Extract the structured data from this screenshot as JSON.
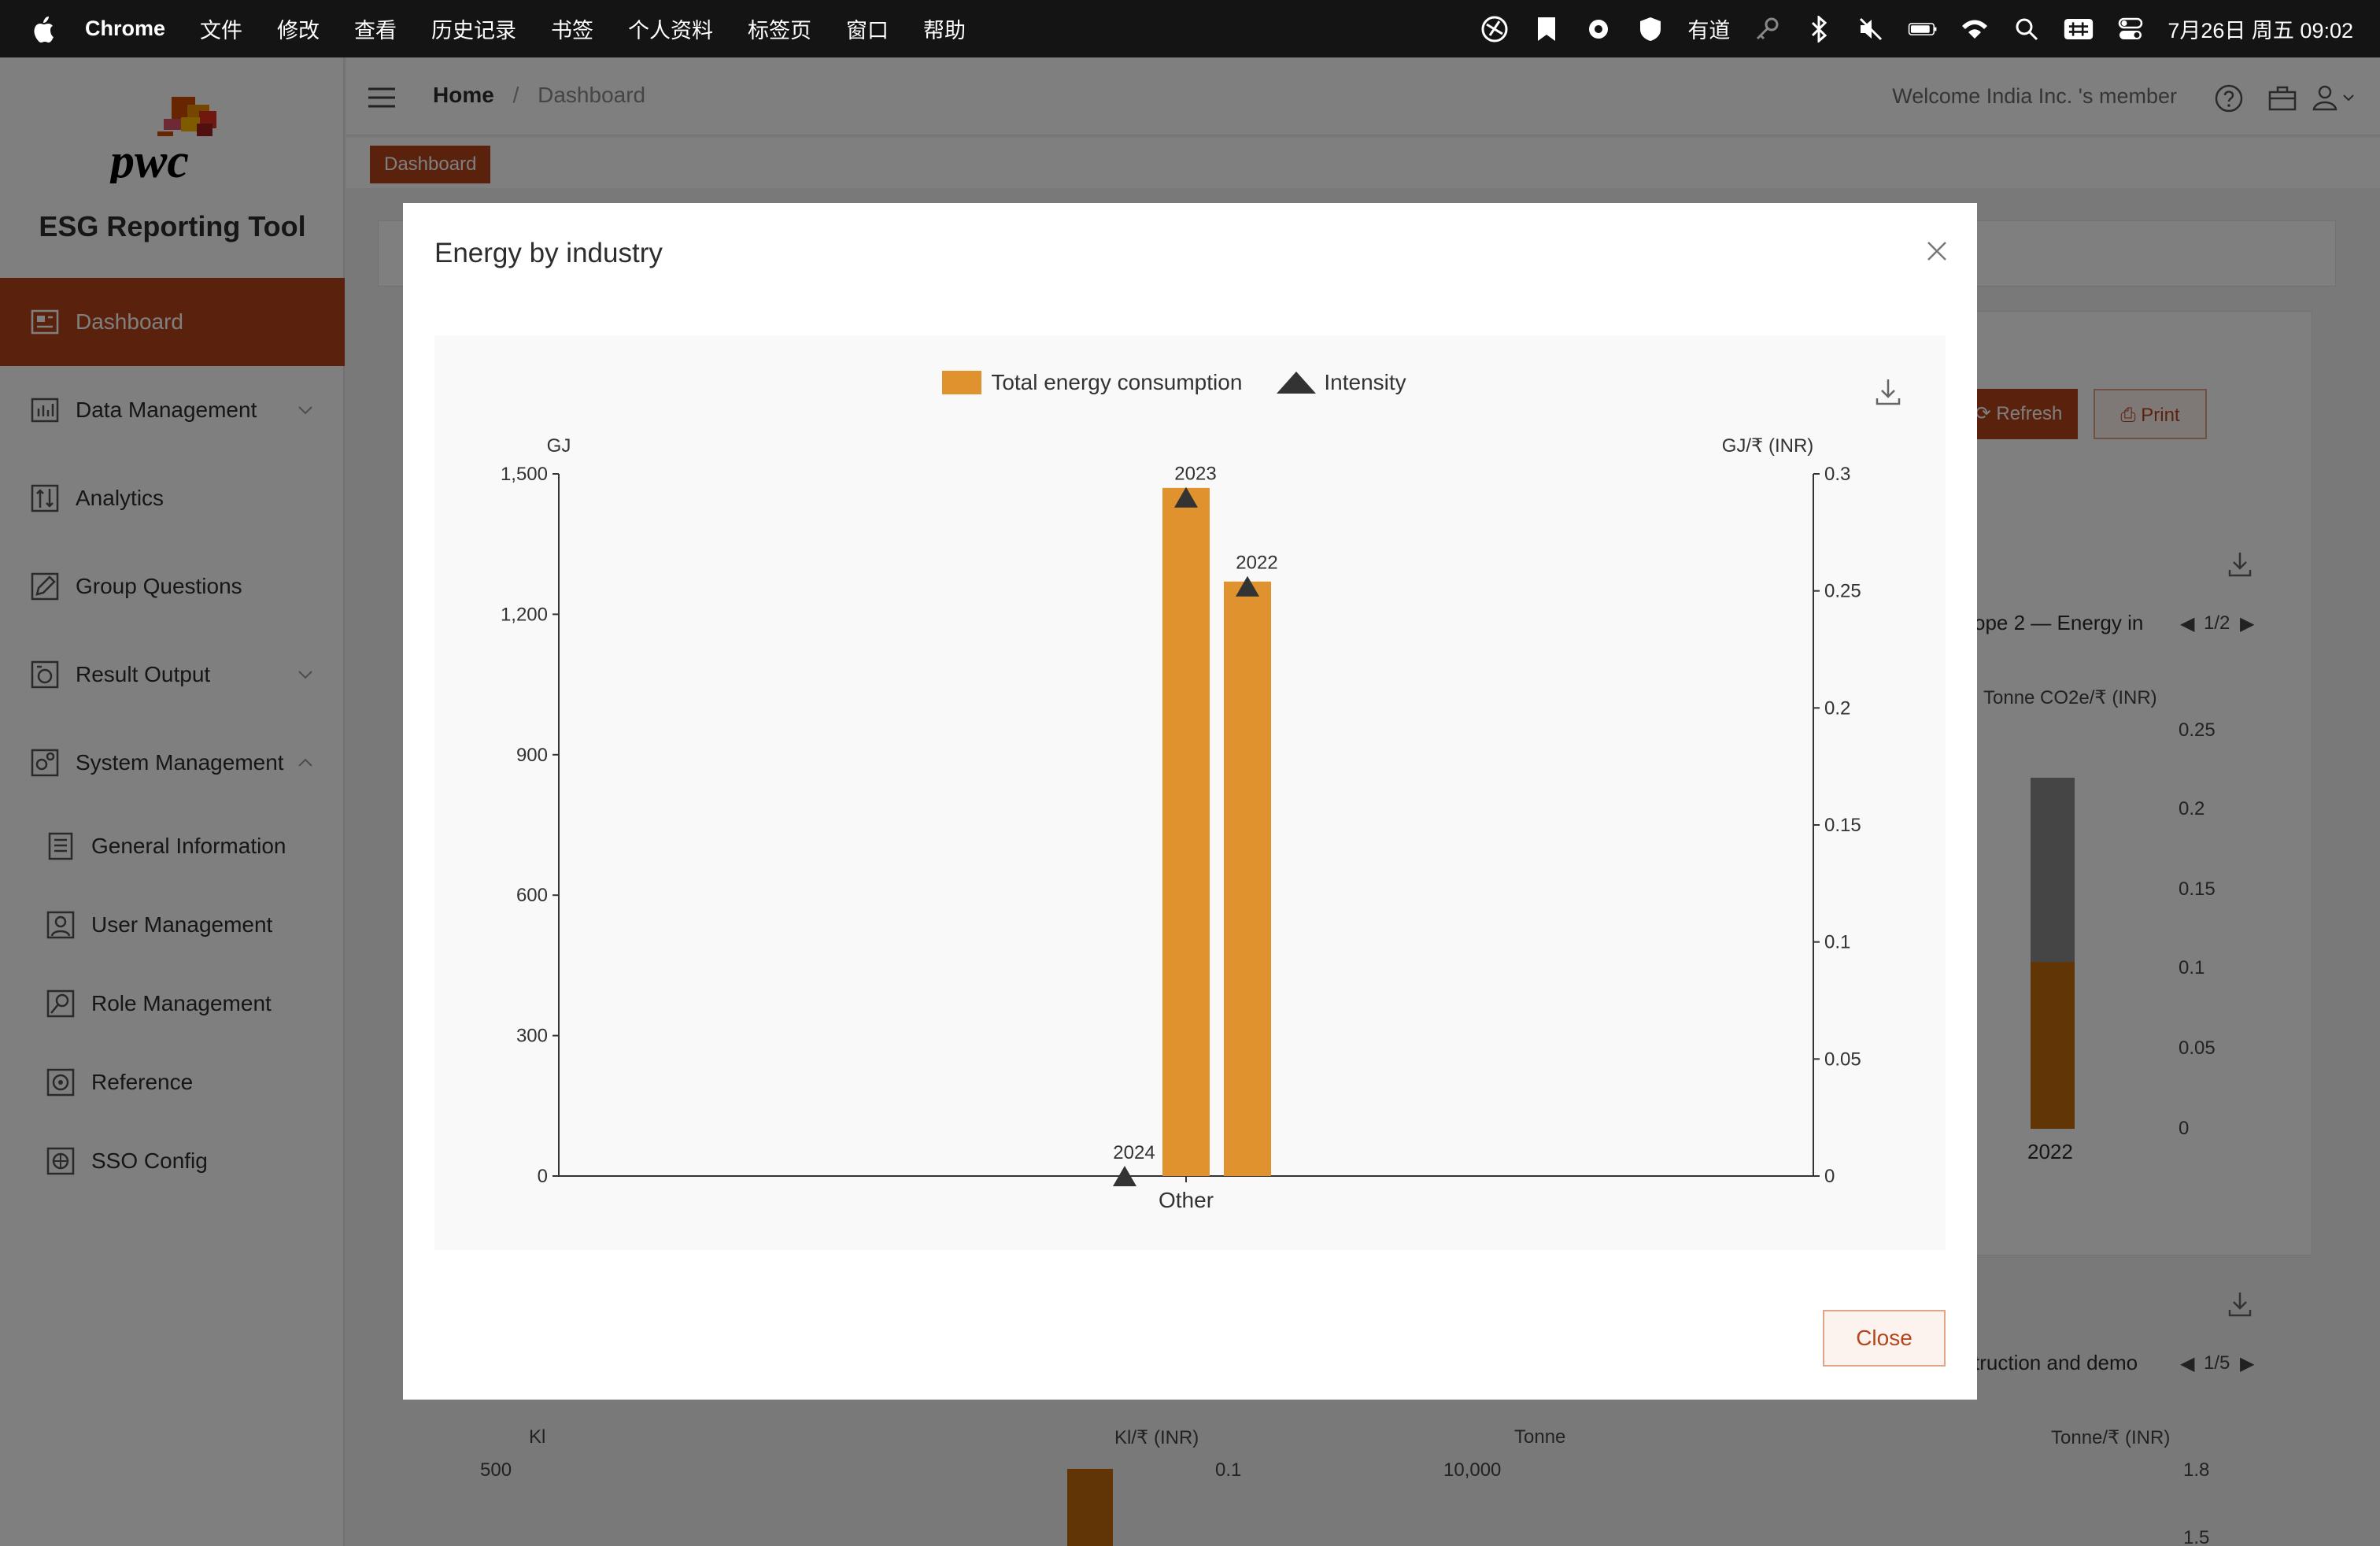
{
  "menubar": {
    "app_name": "Chrome",
    "menus": [
      "文件",
      "修改",
      "查看",
      "历史记录",
      "书签",
      "个人资料",
      "标签页",
      "窗口",
      "帮助"
    ],
    "youdao": "有道",
    "datetime": "7月26日 周五 09:02"
  },
  "sidebar": {
    "logo_text": "pwc",
    "app_title": "ESG Reporting Tool",
    "items": [
      {
        "label": "Dashboard",
        "icon": "dashboard-icon"
      },
      {
        "label": "Data Management",
        "icon": "data-icon"
      },
      {
        "label": "Analytics",
        "icon": "analytics-icon"
      },
      {
        "label": "Group Questions",
        "icon": "edit-icon"
      },
      {
        "label": "Result Output",
        "icon": "output-icon"
      },
      {
        "label": "System Management",
        "icon": "system-icon"
      },
      {
        "label": "General Information",
        "icon": "document-icon"
      },
      {
        "label": "User Management",
        "icon": "user-icon"
      },
      {
        "label": "Role Management",
        "icon": "role-icon"
      },
      {
        "label": "Reference",
        "icon": "reference-icon"
      },
      {
        "label": "SSO Config",
        "icon": "sso-icon"
      }
    ]
  },
  "header": {
    "breadcrumb_home": "Home",
    "breadcrumb_sep": "/",
    "breadcrumb_current": "Dashboard",
    "welcome": "Welcome India Inc. 's member",
    "tag": "Dashboard"
  },
  "background": {
    "refresh": "Refresh",
    "print": "Print",
    "scope_title": "ope 2 — Energy in",
    "scope_pager": "1/2",
    "tonne_axis": "Tonne CO2e/₹ (INR)",
    "tonne_ticks": [
      "0.25",
      "0.2",
      "0.15",
      "0.1",
      "0.05",
      "0"
    ],
    "year": "2022",
    "construction_title": "truction and demo",
    "construction_pager": "1/5",
    "kl": "Kl",
    "kl_inr": "Kl/₹ (INR)",
    "tonne": "Tonne",
    "tonne_inr": "Tonne/₹ (INR)",
    "kl_500": "500",
    "kl_01": "0.1",
    "tonne_10000": "10,000",
    "tonne_18": "1.8",
    "tonne_15": "1.5"
  },
  "modal": {
    "title": "Energy by industry",
    "close_button": "Close"
  },
  "chart_data": {
    "type": "bar",
    "title": "Energy by industry",
    "categories": [
      "Other"
    ],
    "ylabel_left": "GJ",
    "ylabel_right": "GJ/₹ (INR)",
    "ylim_left": [
      0,
      1500
    ],
    "ylim_right": [
      0,
      0.3
    ],
    "yticks_left": [
      "0",
      "300",
      "600",
      "900",
      "1,200",
      "1,500"
    ],
    "yticks_right": [
      "0",
      "0.05",
      "0.1",
      "0.15",
      "0.2",
      "0.25",
      "0.3"
    ],
    "legend": [
      "Total energy consumption",
      "Intensity"
    ],
    "legend_position": "top-center",
    "series": [
      {
        "name": "Total energy consumption",
        "kind": "bar",
        "color": "#e0922f",
        "points": [
          {
            "label": "2024",
            "value": 0
          },
          {
            "label": "2023",
            "value": 1470
          },
          {
            "label": "2022",
            "value": 1270
          }
        ]
      },
      {
        "name": "Intensity",
        "kind": "triangle",
        "color": "#333333",
        "points": [
          {
            "label": "2024",
            "value": 0
          },
          {
            "label": "2023",
            "value": 0.29
          },
          {
            "label": "2022",
            "value": 0.252
          }
        ]
      }
    ]
  }
}
